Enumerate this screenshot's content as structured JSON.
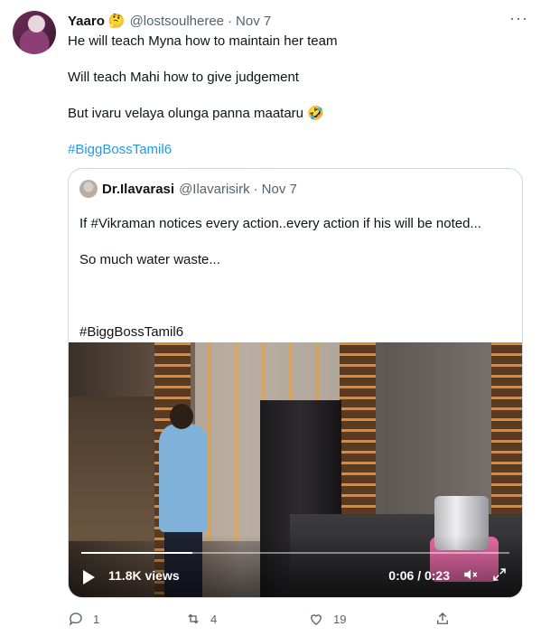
{
  "tweet": {
    "author_name": "Yaaro",
    "author_emoji": "🤔",
    "handle": "@lostsoulheree",
    "date": "Nov 7",
    "more_icon": "more-dots-icon",
    "lines": [
      "He will teach Myna how to maintain her team",
      "Will teach Mahi how to give judgement",
      "But ivaru velaya olunga panna maataru 🤣",
      "#BiggBossTamil6"
    ]
  },
  "quote": {
    "author_name": "Dr.Ilavarasi",
    "handle": "@Ilavarisirk",
    "date": "Nov 7",
    "lines": [
      "If #Vikraman notices every action..every action if his will be noted...",
      "So much water waste...",
      "#BiggBossTamil6"
    ],
    "video": {
      "views": "11.8K views",
      "time": "0:06 / 0:23",
      "progress": 0.26,
      "play_icon": "play-icon",
      "volume_icon": "mute-icon",
      "fullscreen_icon": "fullscreen-icon"
    }
  },
  "actions": {
    "reply_count": "1",
    "retweet_count": "4",
    "like_count": "19"
  },
  "colors": {
    "link": "#1d9bf0",
    "muted": "#536471",
    "border": "#cfd9de"
  }
}
